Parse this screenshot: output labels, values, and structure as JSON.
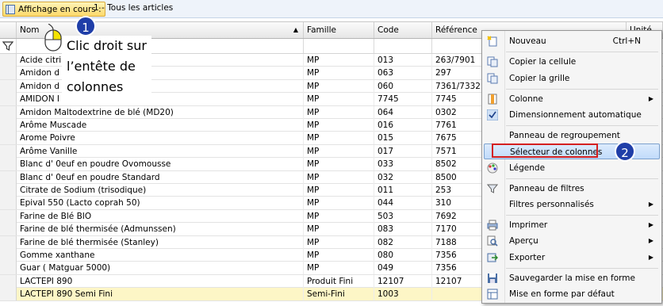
{
  "toolbar": {
    "view_button_label": "Affichage en cours :",
    "view_value": "1 - Tous les articles"
  },
  "grid": {
    "columns": [
      "Nom",
      "Famille",
      "Code",
      "Référence",
      "Unité de b"
    ],
    "rows": [
      {
        "nom": "Acide citri",
        "famille": "MP",
        "code": "013",
        "reference": "263/7901"
      },
      {
        "nom": "Amidon d",
        "famille": "MP",
        "code": "063",
        "reference": "297"
      },
      {
        "nom": "Amidon d",
        "famille": "MP",
        "code": "060",
        "reference": "7361/7332"
      },
      {
        "nom": "AMIDON I",
        "famille": "MP",
        "code": "7745",
        "reference": "7745"
      },
      {
        "nom": "Amidon Maltodextrine de blé (MD20)",
        "famille": "MP",
        "code": "064",
        "reference": "0302"
      },
      {
        "nom": "Arôme Muscade",
        "famille": "MP",
        "code": "016",
        "reference": "7761"
      },
      {
        "nom": "Arome Poivre",
        "famille": "MP",
        "code": "015",
        "reference": "7675"
      },
      {
        "nom": "Arôme Vanille",
        "famille": "MP",
        "code": "017",
        "reference": "7571"
      },
      {
        "nom": "Blanc d' 0euf en poudre Ovomousse",
        "famille": "MP",
        "code": "033",
        "reference": "8502"
      },
      {
        "nom": "Blanc d' 0euf en poudre Standard",
        "famille": "MP",
        "code": "032",
        "reference": "8500"
      },
      {
        "nom": "Citrate de Sodium (trisodique)",
        "famille": "MP",
        "code": "011",
        "reference": "253"
      },
      {
        "nom": "Epival 550 (Lacto coprah 50)",
        "famille": "MP",
        "code": "044",
        "reference": "310"
      },
      {
        "nom": "Farine de Blé BIO",
        "famille": "MP",
        "code": "503",
        "reference": "7692"
      },
      {
        "nom": "Farine de blé thermisée (Admunssen)",
        "famille": "MP",
        "code": "083",
        "reference": "7170"
      },
      {
        "nom": "Farine de blé thermisée (Stanley)",
        "famille": "MP",
        "code": "082",
        "reference": "7188"
      },
      {
        "nom": "Gomme xanthane",
        "famille": "MP",
        "code": "080",
        "reference": "7356"
      },
      {
        "nom": "Guar ( Matguar 5000)",
        "famille": "MP",
        "code": "049",
        "reference": "7356"
      },
      {
        "nom": "LACTEPI 890",
        "famille": "Produit Fini",
        "code": "12107",
        "reference": "12107"
      },
      {
        "nom": "LACTEPI 890 Semi Fini",
        "famille": "Semi-Fini",
        "code": "1003",
        "reference": ""
      }
    ]
  },
  "annotation": {
    "step1_badge": "1",
    "step1_lines": [
      "Clic droit sur",
      "l’entête de",
      "colonnes"
    ],
    "step2_badge": "2"
  },
  "context_menu": {
    "items": [
      {
        "label": "Nouveau",
        "shortcut": "Ctrl+N",
        "icon": "new-doc-icon"
      },
      {
        "label": "Copier la cellule",
        "icon": "copy-icon"
      },
      {
        "label": "Copier la grille",
        "icon": "copy-icon"
      },
      {
        "label": "Colonne",
        "icon": "column-icon",
        "submenu": true
      },
      {
        "label": "Dimensionnement automatique",
        "icon": "check-icon"
      },
      {
        "label": "Panneau de regroupement"
      },
      {
        "label": "Sélecteur de colonnes",
        "highlighted": true
      },
      {
        "label": "Légende",
        "icon": "palette-icon"
      },
      {
        "label": "Panneau de filtres",
        "icon": "filter-icon"
      },
      {
        "label": "Filtres personnalisés",
        "submenu": true
      },
      {
        "label": "Imprimer",
        "icon": "printer-icon",
        "submenu": true
      },
      {
        "label": "Aperçu",
        "icon": "preview-icon",
        "submenu": true
      },
      {
        "label": "Exporter",
        "icon": "export-icon",
        "submenu": true
      },
      {
        "label": "Sauvegarder la mise en forme",
        "icon": "save-icon"
      },
      {
        "label": "Mise en forme par défaut",
        "icon": "default-layout-icon"
      }
    ]
  },
  "colors": {
    "selected_row": "#fdf6c6",
    "badge": "#1f3ea8",
    "highlight_border": "#d42020"
  }
}
